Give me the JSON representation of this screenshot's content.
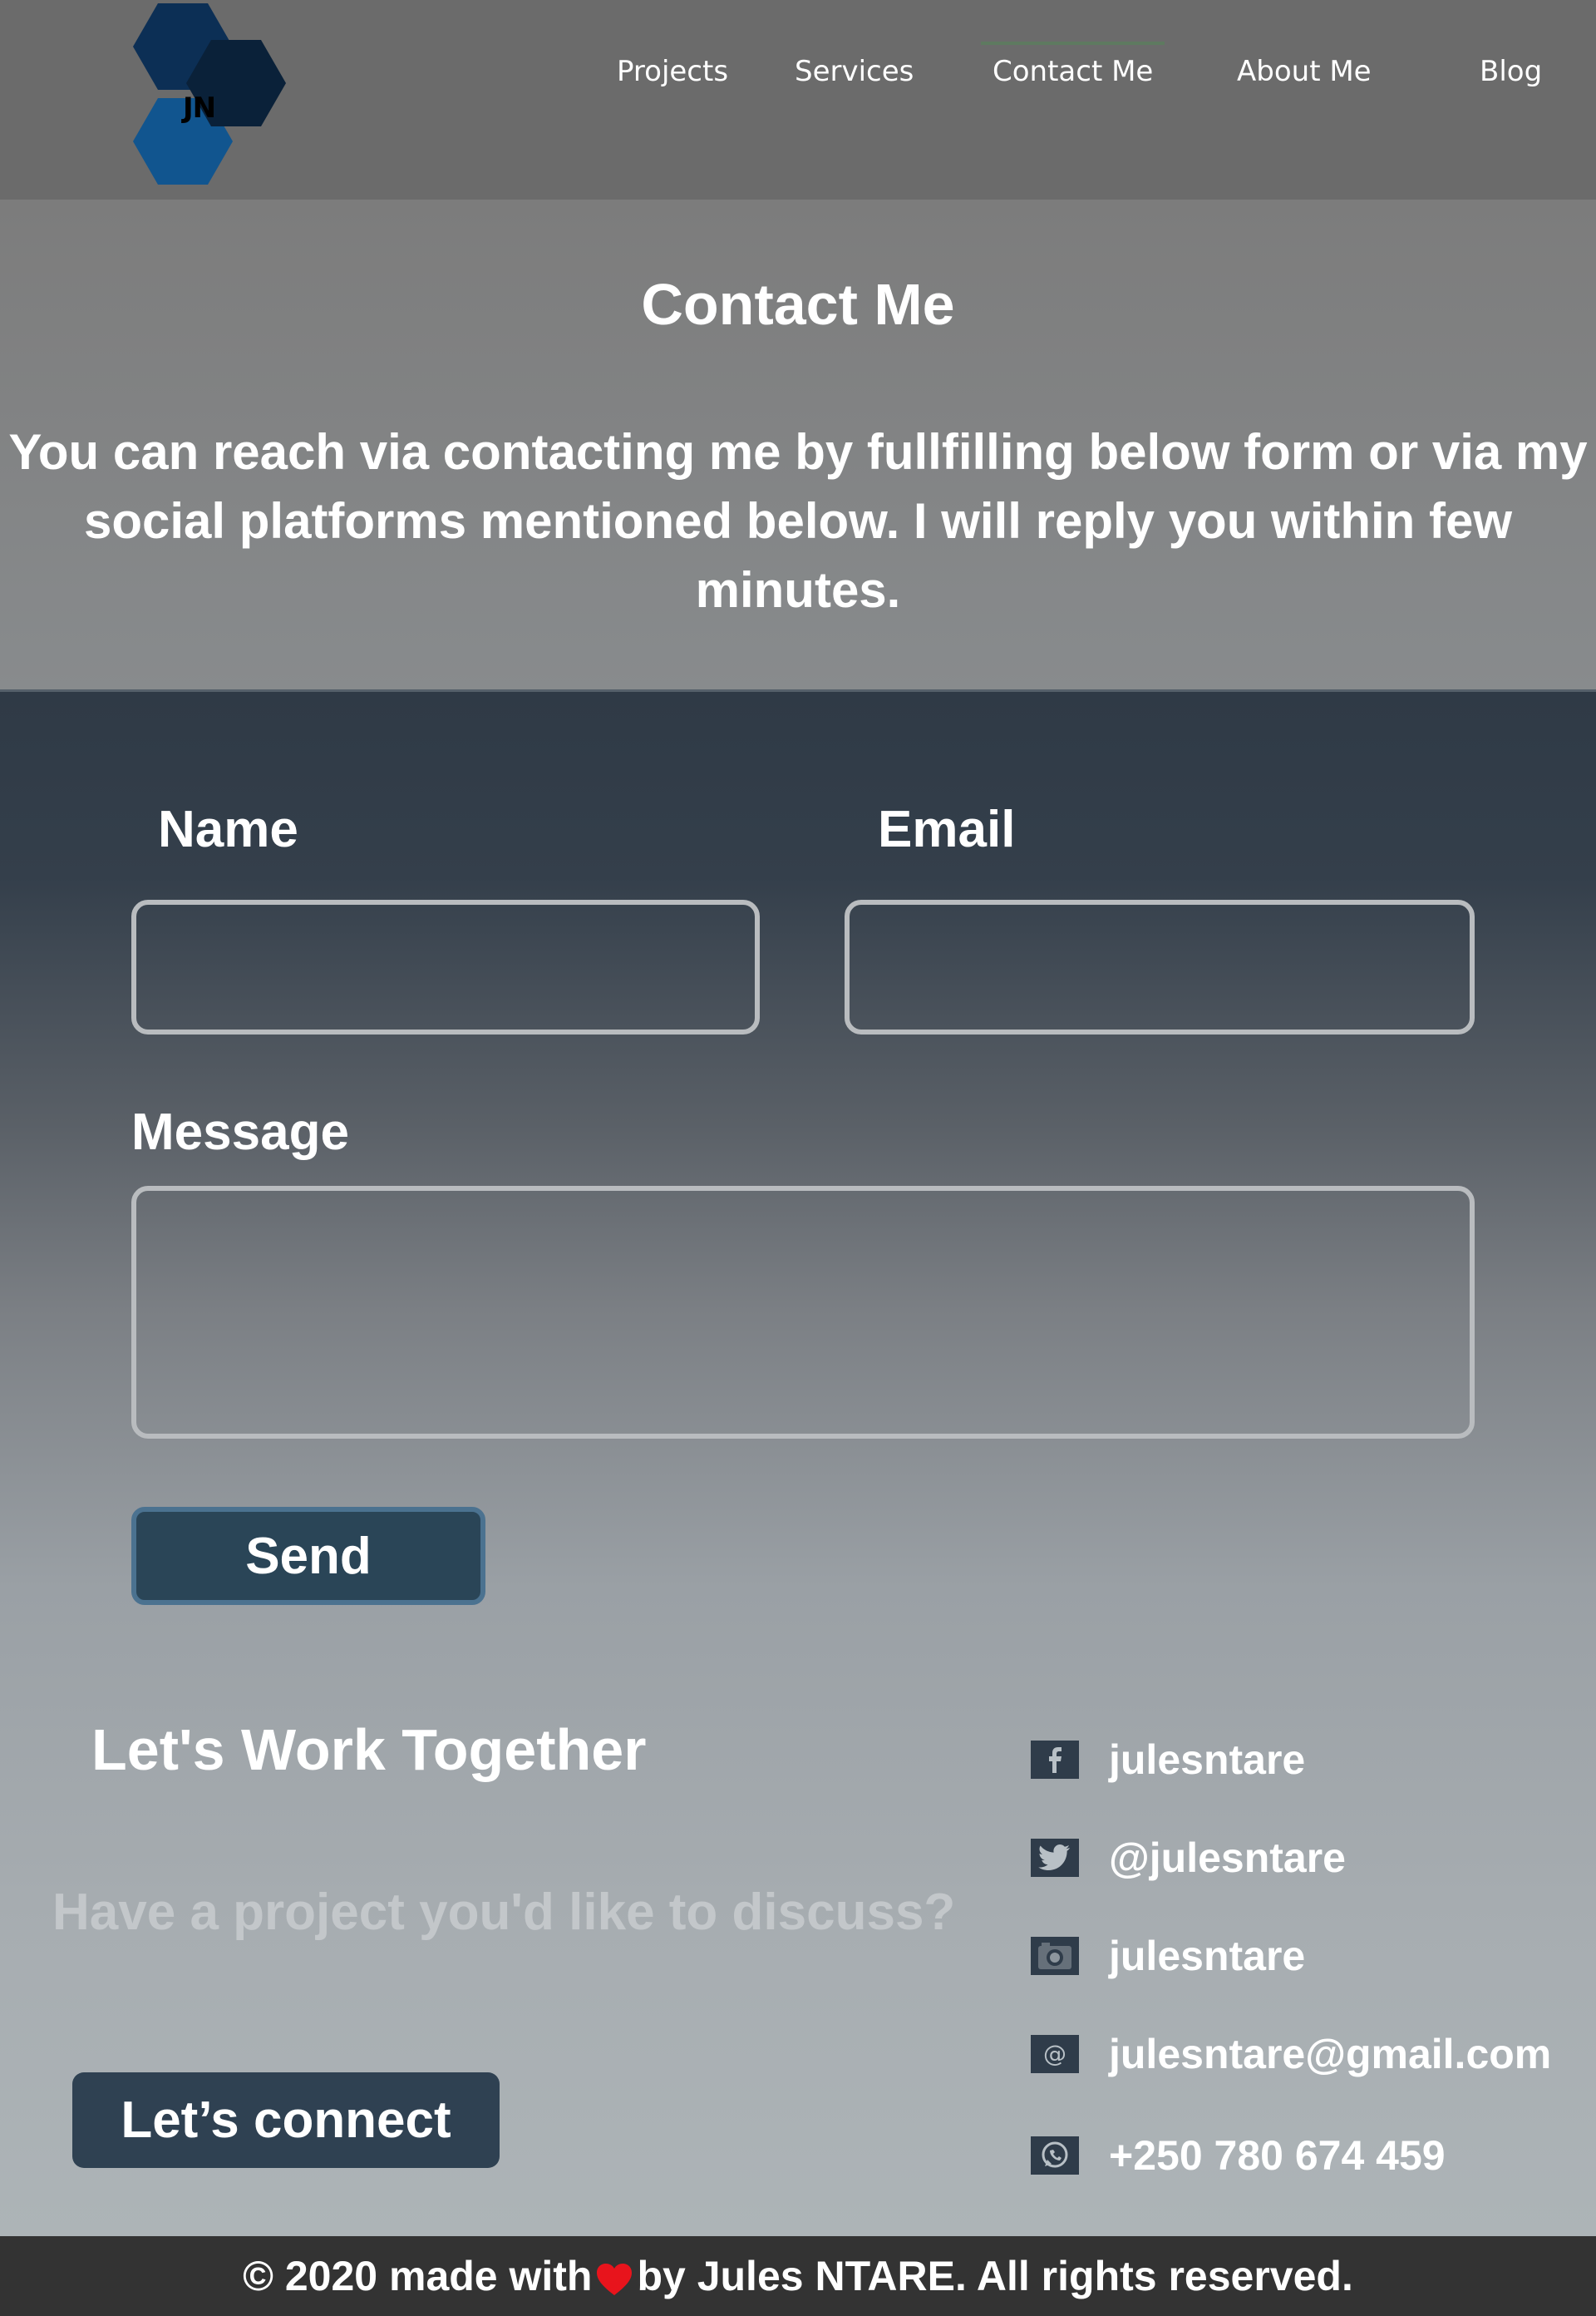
{
  "brand": {
    "logo_text": "JN"
  },
  "nav": {
    "items": [
      {
        "label": "Projects"
      },
      {
        "label": "Services"
      },
      {
        "label": "Contact Me",
        "active": true
      },
      {
        "label": "About Me"
      },
      {
        "label": "Blog"
      }
    ]
  },
  "intro": {
    "title": "Contact Me",
    "text": "You can reach via contacting me by fullfilling below form or via my social platforms mentioned below. I will reply you within few minutes."
  },
  "form": {
    "name_label": "Name",
    "name_value": "",
    "email_label": "Email",
    "email_value": "",
    "message_label": "Message",
    "message_value": "",
    "send_label": "Send"
  },
  "work": {
    "title": "Let's Work Together",
    "subtitle": "Have a project you'd like to discuss?",
    "button_label": "Let’s connect"
  },
  "socials": [
    {
      "icon": "facebook-icon",
      "text": "julesntare"
    },
    {
      "icon": "twitter-icon",
      "text": "@julesntare"
    },
    {
      "icon": "camera-icon",
      "text": "julesntare"
    },
    {
      "icon": "at-sign-icon",
      "text": "julesntare@gmail.com"
    },
    {
      "icon": "whatsapp-icon",
      "text": "+250 780 674 459"
    }
  ],
  "footer": {
    "before": "© 2020 made with",
    "after": "by Jules NTARE. All rights reserved."
  },
  "colors": {
    "header_bg": "#6b6b6b",
    "form_top": "#2f3a46",
    "button_bg": "#2a4557",
    "heart": "#e8141c",
    "footer_bg": "#333333"
  }
}
